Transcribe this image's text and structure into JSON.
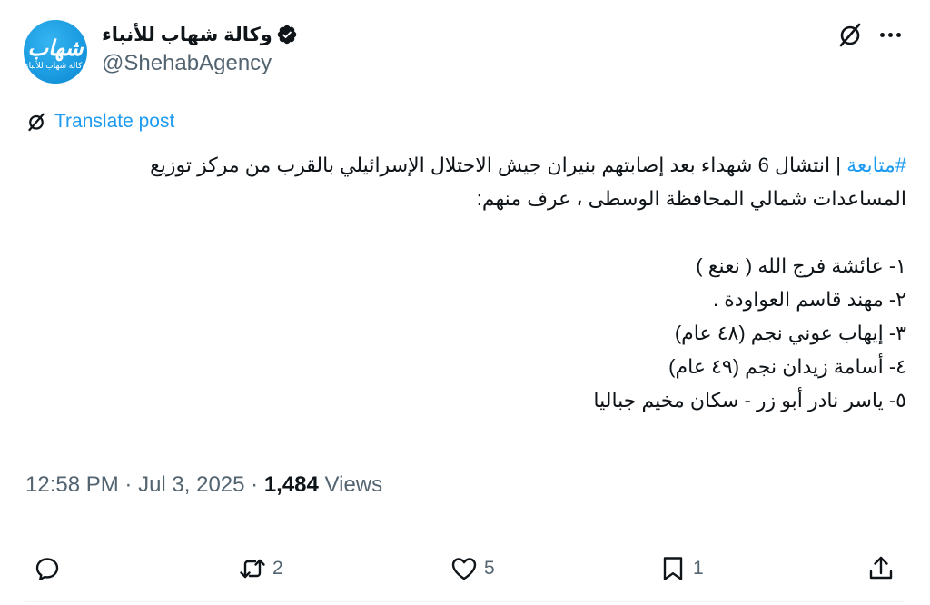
{
  "author": {
    "display_name": "وكالة شهاب للأنباء",
    "handle": "@ShehabAgency",
    "avatar_logo_main": "شهاب",
    "avatar_logo_sub": "وكالة شهاب للأنباء",
    "verified_icon": "verified-badge-icon"
  },
  "header_actions": {
    "grok_icon": "grok-icon",
    "more_icon": "more-icon"
  },
  "translate": {
    "label": "Translate post",
    "icon": "grok-icon"
  },
  "tweet": {
    "hashtag": "#متابعة",
    "line1_rest": " | انتشال 6 شهداء بعد إصابتهم بنيران جيش الاحتلال الإسرائيلي بالقرب من مركز توزيع",
    "line2": "المساعدات شمالي المحافظة الوسطى ، عرف منهم:",
    "list": [
      "١-  عائشة فرج الله ( نعنع )",
      "٢-  مهند قاسم العواودة .",
      "٣- إيهاب عوني نجم (٤٨ عام)",
      "٤- أسامة زيدان نجم (٤٩ عام)",
      "٥- ياسر نادر أبو زر - سكان مخيم جباليا"
    ]
  },
  "meta": {
    "time": "12:58 PM",
    "separator": " · ",
    "date": "Jul 3, 2025",
    "views_count": "1,484",
    "views_label": " Views"
  },
  "actions": {
    "reply": {
      "icon": "reply-icon",
      "count": ""
    },
    "repost": {
      "icon": "repost-icon",
      "count": "2"
    },
    "like": {
      "icon": "like-icon",
      "count": "5"
    },
    "bookmark": {
      "icon": "bookmark-icon",
      "count": "1"
    },
    "share": {
      "icon": "share-icon",
      "count": ""
    }
  },
  "colors": {
    "accent": "#1d9bf0",
    "text_primary": "#0f1419",
    "text_secondary": "#536471",
    "divider": "#eff3f4"
  }
}
